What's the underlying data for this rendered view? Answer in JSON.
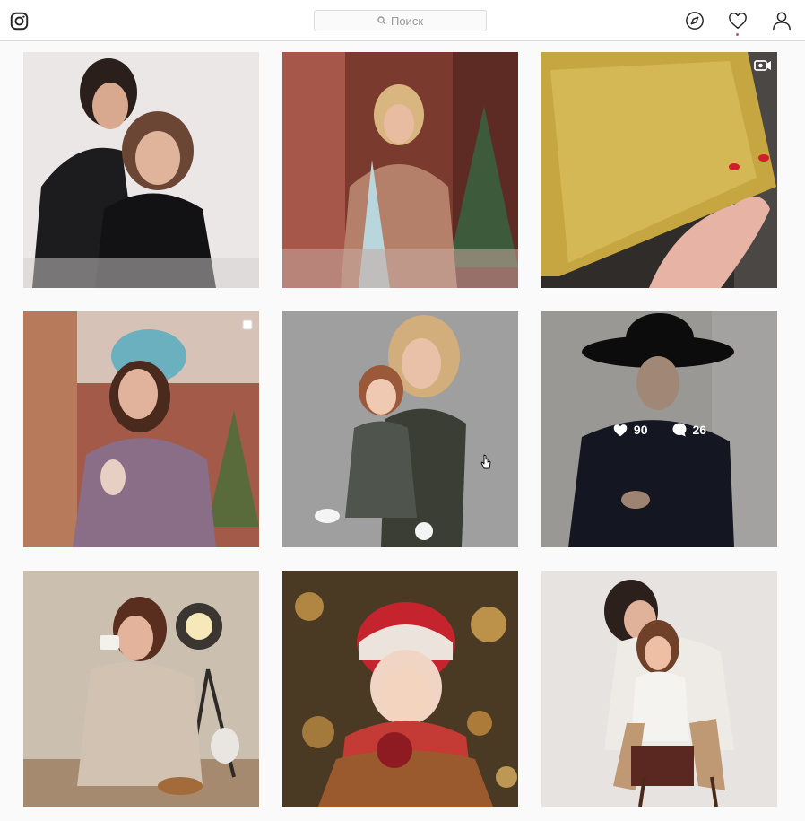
{
  "header": {
    "search": {
      "placeholder": "Поиск"
    },
    "icons": [
      "instagram-logo-icon",
      "search-icon",
      "compass-icon",
      "heart-icon",
      "user-icon"
    ],
    "notification_dot_color": "#ed4956"
  },
  "colors": {
    "background": "#fafafa",
    "header_bg": "#ffffff",
    "border": "#dbdbdb",
    "text_muted": "#999999"
  },
  "grid": {
    "posts": [
      {
        "id": "post-1",
        "badge": null
      },
      {
        "id": "post-2",
        "badge": null
      },
      {
        "id": "post-3",
        "badge": "video-icon"
      },
      {
        "id": "post-4",
        "badge": "carousel-icon"
      },
      {
        "id": "post-5",
        "badge": null
      },
      {
        "id": "post-6",
        "badge": null,
        "hover": {
          "likes": "90",
          "comments": "26"
        }
      },
      {
        "id": "post-7",
        "badge": null
      },
      {
        "id": "post-8",
        "badge": null
      },
      {
        "id": "post-9",
        "badge": null
      }
    ]
  }
}
